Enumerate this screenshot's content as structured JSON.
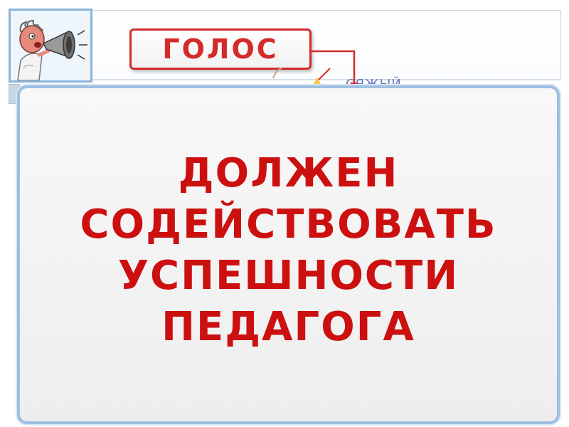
{
  "top": {
    "voice_label": "ГОЛОС",
    "peek_text": "СЯЖЫЙ"
  },
  "main_card": {
    "lines": [
      "ДОЛЖЕН",
      "СОДЕЙСТВОВАТЬ",
      "УСПЕШНОСТИ",
      "ПЕДАГОГА"
    ]
  },
  "colors": {
    "accent_red": "#cc1010",
    "label_red": "#d42a2a",
    "card_border": "#9dbfe0"
  },
  "icons": {
    "illustration": "man-shouting-into-megaphone"
  }
}
